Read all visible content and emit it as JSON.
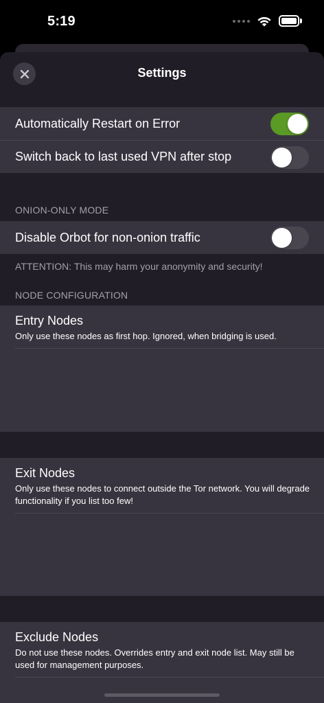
{
  "status_bar": {
    "time": "5:19"
  },
  "nav": {
    "title": "Settings",
    "close_icon": "close-x-icon"
  },
  "general": {
    "items": [
      {
        "label": "Automatically Restart on Error",
        "enabled": true
      },
      {
        "label": "Switch back to last used VPN after stop",
        "enabled": false
      }
    ]
  },
  "onion_only": {
    "header": "ONION-ONLY MODE",
    "items": [
      {
        "label": "Disable Orbot for non-onion traffic",
        "enabled": false
      }
    ],
    "footer": "ATTENTION: This may harm your anonymity and security!"
  },
  "node_configuration": {
    "header": "NODE CONFIGURATION",
    "entry": {
      "title": "Entry Nodes",
      "description": "Only use these nodes as first hop. Ignored, when bridging is used.",
      "value": ""
    },
    "exit": {
      "title": "Exit Nodes",
      "description": "Only use these nodes to connect outside the Tor network. You will degrade functionality if you list too few!",
      "value": ""
    },
    "exclude": {
      "title": "Exclude Nodes",
      "description": "Do not use these nodes. Overrides entry and exit node list. May still be used for management purposes.",
      "value": ""
    }
  },
  "colors": {
    "toggle_on": "#5a9a25",
    "toggle_off": "#4a4650",
    "cell_background": "#38343f",
    "sheet_background": "#201d27"
  }
}
